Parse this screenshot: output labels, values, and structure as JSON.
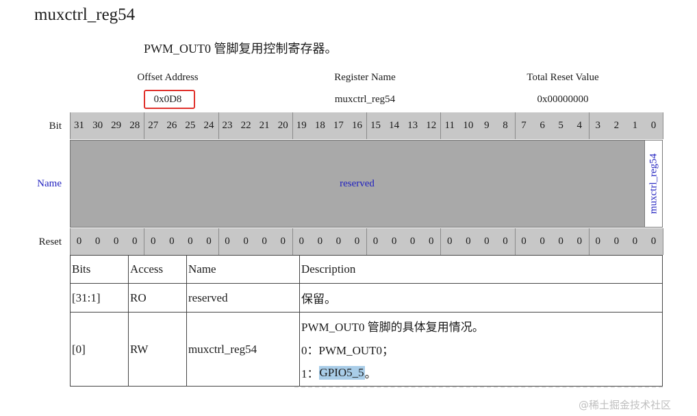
{
  "doc": {
    "title": "muxctrl_reg54",
    "subtitle": "PWM_OUT0 管脚复用控制寄存器。"
  },
  "header": {
    "offset_label": "Offset Address",
    "offset_value": "0x0D8",
    "name_label": "Register Name",
    "name_value": "muxctrl_reg54",
    "reset_label": "Total Reset Value",
    "reset_value": "0x00000000"
  },
  "register": {
    "bit_label": "Bit",
    "name_label": "Name",
    "reset_label": "Reset",
    "bits": [
      "31",
      "30",
      "29",
      "28",
      "27",
      "26",
      "25",
      "24",
      "23",
      "22",
      "21",
      "20",
      "19",
      "18",
      "17",
      "16",
      "15",
      "14",
      "13",
      "12",
      "11",
      "10",
      "9",
      "8",
      "7",
      "6",
      "5",
      "4",
      "3",
      "2",
      "1",
      "0"
    ],
    "resets": [
      "0",
      "0",
      "0",
      "0",
      "0",
      "0",
      "0",
      "0",
      "0",
      "0",
      "0",
      "0",
      "0",
      "0",
      "0",
      "0",
      "0",
      "0",
      "0",
      "0",
      "0",
      "0",
      "0",
      "0",
      "0",
      "0",
      "0",
      "0",
      "0",
      "0",
      "0",
      "0"
    ],
    "fields": [
      {
        "name": "reserved"
      },
      {
        "name": "muxctrl_reg54"
      }
    ]
  },
  "table": {
    "headers": [
      "Bits",
      "Access",
      "Name",
      "Description"
    ],
    "rows": [
      {
        "bits": "[31:1]",
        "access": "RO",
        "name": "reserved",
        "desc": [
          "保留。"
        ]
      },
      {
        "bits": "[0]",
        "access": "RW",
        "name": "muxctrl_reg54",
        "desc": [
          "PWM_OUT0 管脚的具体复用情况。",
          "0：PWM_OUT0；",
          "1：",
          "GPIO5_5",
          "。"
        ]
      }
    ]
  },
  "colors": {
    "highlight_box": "#e0302a",
    "field_text": "#1f1fbf",
    "bit_bg": "#c7c7c7",
    "name_bg": "#a9a9a9",
    "selection": "#a9cde8"
  },
  "watermark": "@稀土掘金技术社区"
}
